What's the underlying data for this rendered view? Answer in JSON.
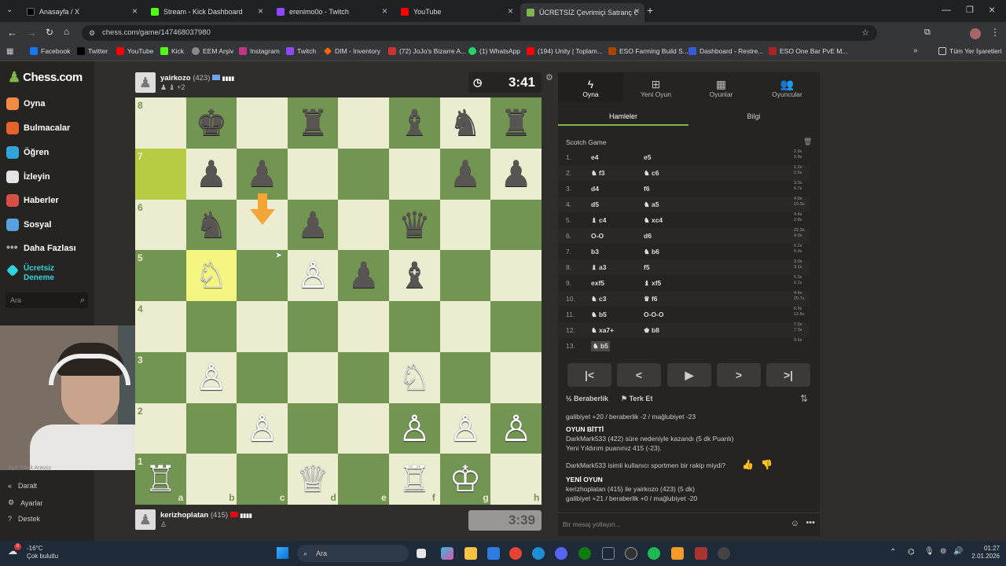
{
  "tabs": [
    {
      "title": "Anasayfa / X",
      "color": "#000"
    },
    {
      "title": "Stream - Kick Dashboard",
      "color": "#53fc18"
    },
    {
      "title": "erenimo0o - Twitch",
      "color": "#9146ff"
    },
    {
      "title": "YouTube",
      "color": "#ff0000"
    },
    {
      "title": "ÜCRETSİZ Çevrimiçi Satranç Oy",
      "color": "#81b64c"
    }
  ],
  "url": "chess.com/game/147468037980",
  "bookmarks": [
    "Facebook",
    "Twitter",
    "YouTube",
    "Kick",
    "EEM Arşiv",
    "Instagram",
    "Twitch",
    "DIM - Inventory",
    "(72) JoJo's Bizarre A...",
    "(1) WhatsApp",
    "(194) Unity | Toplam...",
    "ESO Farming Build S...",
    "Dashboard - Restre...",
    "ESO One Bar PvE M..."
  ],
  "all_bookmarks": "Tüm Yer İşaretleri",
  "logo": "Chess.com",
  "nav": [
    {
      "label": "Oyna",
      "color": "#f28b44"
    },
    {
      "label": "Bulmacalar",
      "color": "#e8632b"
    },
    {
      "label": "Öğren",
      "color": "#31a4d9"
    },
    {
      "label": "İzleyin",
      "color": "#e5e5e5"
    },
    {
      "label": "Haberler",
      "color": "#d65046"
    },
    {
      "label": "Sosyal",
      "color": "#58a1e0"
    },
    {
      "label": "Daha Fazlası",
      "color": "#aaaaaa"
    },
    {
      "label": "Ücretsiz Deneme",
      "color": "#2fd3e0"
    }
  ],
  "search_placeholder": "Ara",
  "bottom_nav": [
    "Açık Renk Arayüz",
    "Daralt",
    "Ayarlar",
    "Destek"
  ],
  "top_player": {
    "name": "yairkozo",
    "rating": "(423)",
    "captured": "♟ ♝ +2",
    "clock": "3:41"
  },
  "bottom_player": {
    "name": "kerizhoplatan",
    "rating": "(415)",
    "clock": "3:39"
  },
  "ranks": [
    "8",
    "7",
    "6",
    "5",
    "4",
    "3",
    "2",
    "1"
  ],
  "files": [
    "a",
    "b",
    "c",
    "d",
    "e",
    "f",
    "g",
    "h"
  ],
  "pieces": [
    {
      "g": "♚",
      "c": "b",
      "f": 1,
      "r": 0
    },
    {
      "g": "♜",
      "c": "b",
      "f": 3,
      "r": 0
    },
    {
      "g": "♝",
      "c": "b",
      "f": 5,
      "r": 0
    },
    {
      "g": "♞",
      "c": "b",
      "f": 6,
      "r": 0
    },
    {
      "g": "♜",
      "c": "b",
      "f": 7,
      "r": 0
    },
    {
      "g": "♟",
      "c": "b",
      "f": 1,
      "r": 1
    },
    {
      "g": "♟",
      "c": "b",
      "f": 2,
      "r": 1
    },
    {
      "g": "♟",
      "c": "b",
      "f": 6,
      "r": 1
    },
    {
      "g": "♟",
      "c": "b",
      "f": 7,
      "r": 1
    },
    {
      "g": "♞",
      "c": "b",
      "f": 1,
      "r": 2
    },
    {
      "g": "♟",
      "c": "b",
      "f": 3,
      "r": 2
    },
    {
      "g": "♛",
      "c": "b",
      "f": 5,
      "r": 2
    },
    {
      "g": "♘",
      "c": "w",
      "f": 1,
      "r": 3
    },
    {
      "g": "♙",
      "c": "w",
      "f": 3,
      "r": 3
    },
    {
      "g": "♟",
      "c": "b",
      "f": 4,
      "r": 3
    },
    {
      "g": "♝",
      "c": "b",
      "f": 5,
      "r": 3
    },
    {
      "g": "♘",
      "c": "w",
      "f": 5,
      "r": 5
    },
    {
      "g": "♙",
      "c": "w",
      "f": 1,
      "r": 5
    },
    {
      "g": "♙",
      "c": "w",
      "f": 2,
      "r": 6
    },
    {
      "g": "♙",
      "c": "w",
      "f": 5,
      "r": 6
    },
    {
      "g": "♙",
      "c": "w",
      "f": 6,
      "r": 6
    },
    {
      "g": "♙",
      "c": "w",
      "f": 7,
      "r": 6
    },
    {
      "g": "♖",
      "c": "w",
      "f": 0,
      "r": 7
    },
    {
      "g": "♕",
      "c": "w",
      "f": 3,
      "r": 7
    },
    {
      "g": "♖",
      "c": "w",
      "f": 5,
      "r": 7
    },
    {
      "g": "♔",
      "c": "w",
      "f": 6,
      "r": 7
    }
  ],
  "panel_tabs": [
    "Oyna",
    "Yeni Oyun",
    "Oyunlar",
    "Oyuncular"
  ],
  "sub_tabs": [
    "Hamleler",
    "Bilgi"
  ],
  "opening": "Scotch Game",
  "moves": [
    {
      "n": "1.",
      "w": "e4",
      "b": "e5",
      "t": "2.9s 0.8s"
    },
    {
      "n": "2.",
      "w": "♞ f3",
      "b": "♞ c6",
      "t": "1.2s 0.5s"
    },
    {
      "n": "3.",
      "w": "d4",
      "b": "f6",
      "t": "3.0s 6.7s"
    },
    {
      "n": "4.",
      "w": "d5",
      "b": "♞ a5",
      "t": "4.0s 10.3s"
    },
    {
      "n": "5.",
      "w": "♝ c4",
      "b": "♞ xc4",
      "t": "4.4s 2.8s"
    },
    {
      "n": "6.",
      "w": "O-O",
      "b": "d6",
      "t": "22.3s 4.0s"
    },
    {
      "n": "7.",
      "w": "b3",
      "b": "♞ b6",
      "t": "6.2s 5.9s"
    },
    {
      "n": "8.",
      "w": "♝ a3",
      "b": "f5",
      "t": "3.0s 3.1s"
    },
    {
      "n": "9.",
      "w": "exf5",
      "b": "♝ xf5",
      "t": "5.3s 0.1s"
    },
    {
      "n": "10.",
      "w": "♞ c3",
      "b": "♛ f6",
      "t": "4.4s 20.7s"
    },
    {
      "n": "11.",
      "w": "♞ b5",
      "b": "O-O-O",
      "t": "6.9s 13.8s"
    },
    {
      "n": "12.",
      "w": "♞ xa7+",
      "b": "♚ b8",
      "t": "7.2s 7.3s"
    },
    {
      "n": "13.",
      "w": "♞ b5",
      "b": "",
      "t": "9.6s"
    }
  ],
  "actions": {
    "draw": "Beraberlik",
    "resign": "Terk Et"
  },
  "chat": {
    "line1": "galibiyet +20 / beraberlik -2 / mağlubiyet -23",
    "over_title": "OYUN BİTTİ",
    "over_text": "DarkMark533 (422) süre nedeniyle kazandı (5 dk Puanlı)",
    "rating_text": "Yeni Yıldırım puanınız 415 (-23).",
    "sport_q": "DarkMark533 isimli kullanıcı sportmen bir rakip miydi?",
    "new_title": "YENİ OYUN",
    "new_text": "kerizhoplatan (415) ile yairkozo (423) (5 dk)",
    "line2": "galibiyet +21 / beraberlik +0 / mağlubiyet -20",
    "input_placeholder": "Bir mesaj yollayın..."
  },
  "taskbar": {
    "temp": "-16°C",
    "weather": "Çok bulutlu",
    "search": "Ara",
    "time": "01:27",
    "date": "2.01.2026",
    "badge": "8"
  }
}
